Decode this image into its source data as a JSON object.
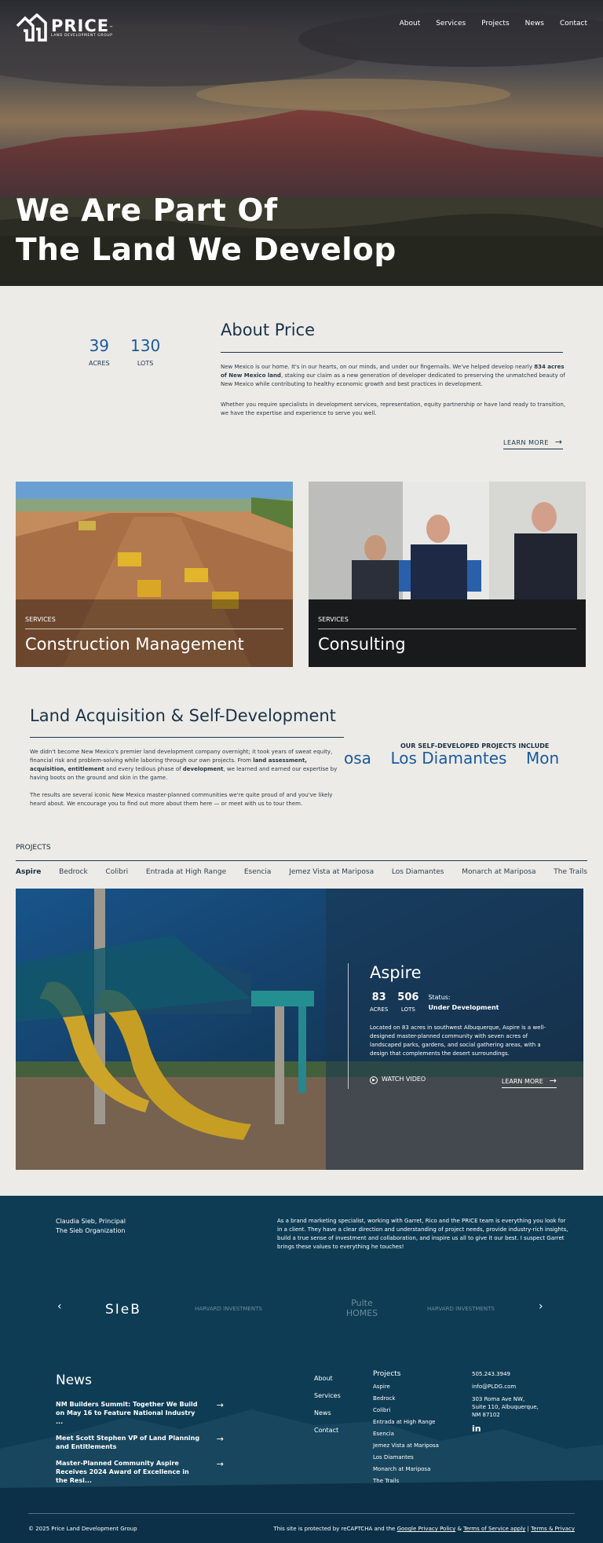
{
  "header": {
    "logo_name": "PRICE",
    "logo_tm": "™",
    "logo_subtitle": "LAND DEVELOPMENT GROUP",
    "nav": [
      "About",
      "Services",
      "Projects",
      "News",
      "Contact"
    ]
  },
  "hero": {
    "title_line1": "We Are Part Of",
    "title_line2": "The Land We Develop"
  },
  "about": {
    "stats": [
      {
        "value": "39",
        "label": "ACRES"
      },
      {
        "value": "130",
        "label": "LOTS"
      }
    ],
    "title": "About Price",
    "p1_a": "New Mexico is our home. It's in our hearts, on our minds, and under our fingernails. We've helped develop nearly ",
    "p1_b": "834 acres of New Mexico land",
    "p1_c": ", staking our claim as a new generation of developer dedicated to preserving the unmatched beauty of New Mexico while contributing to healthy economic growth and best practices in development.",
    "p2": "Whether you require specialists in development services, representation, equity partnership or have land ready to transition, we have the expertise and experience to serve you well.",
    "learn_more": "LEARN MORE"
  },
  "services": [
    {
      "tag": "SERVICES",
      "title": "Construction Management"
    },
    {
      "tag": "SERVICES",
      "title": "Consulting"
    }
  ],
  "acquisition": {
    "title": "Land Acquisition & Self-Development",
    "p1_a": "We didn't become New Mexico's premier land development company overnight; it took years of sweat equity, financial risk and problem-solving while laboring through our own projects. From ",
    "p1_b": "land assessment, acquisition, entitlement",
    "p1_c": " and every tedious phase of ",
    "p1_d": "development",
    "p1_e": ", we learned and earned our expertise by having boots on the ground and skin in the game.",
    "p2": "The results are several iconic New Mexico master-planned communities we're quite proud of and you've likely heard about. We encourage you to find out more about them here — or meet with us to tour them.",
    "marquee_heading": "OUR SELF-DEVELOPED PROJECTS INCLUDE",
    "marquee_items": [
      "osa",
      "Los Diamantes",
      "Mon"
    ]
  },
  "projects": {
    "heading": "PROJECTS",
    "tabs": [
      "Aspire",
      "Bedrock",
      "Colibri",
      "Entrada at High Range",
      "Esencia",
      "Jemez Vista at Mariposa",
      "Los Diamantes",
      "Monarch at Mariposa",
      "The Trails"
    ],
    "active_tab": "Aspire",
    "featured": {
      "name": "Aspire",
      "acres": "83",
      "acres_label": "ACRES",
      "lots": "506",
      "lots_label": "LOTS",
      "status_label": "Status:",
      "status_value": "Under Development",
      "description": "Located on 83 acres in southwest Albuquerque, Aspire is a well-designed master-planned community with seven acres of landscaped parks, gardens, and social gathering areas, with a design that complements the desert surroundings.",
      "watch_video": "WATCH VIDEO",
      "learn_more": "LEARN MORE"
    }
  },
  "testimonial": {
    "name": "Claudia Sieb, Principal",
    "org": "The Sieb Organization",
    "quote": "As a brand marketing specialist, working with Garret, Rico and the PRICE team is everything you look for in a client. They have a clear direction and understanding of project needs, provide industry-rich insights, build a true sense of investment and collaboration, and inspire us all to give it our best. I suspect Garret brings these values to everything he touches!",
    "logos": [
      "SIeB",
      "HARVARD INVESTMENTS",
      "Pulte HOMES",
      "HARVARD INVESTMENTS"
    ]
  },
  "footer": {
    "news_title": "News",
    "news": [
      "NM Builders Summit: Together We Build on May 16 to Feature National Industry ...",
      "Meet Scott Stephen VP of Land Planning and Entitlements",
      "Master-Planned Community Aspire Receives 2024 Award of Excellence in the Resi..."
    ],
    "links": [
      "About",
      "Services",
      "News",
      "Contact"
    ],
    "projects_title": "Projects",
    "projects": [
      "Aspire",
      "Bedrock",
      "Colibri",
      "Entrada at High Range",
      "Esencia",
      "Jemez Vista at Mariposa",
      "Los Diamantes",
      "Monarch at Mariposa",
      "The Trails"
    ],
    "phone": "505.243.3949",
    "email": "info@PLDG.com",
    "addr1": "303 Roma Ave NW,",
    "addr2": "Suite 110, Albuquerque,",
    "addr3": "NM 87102",
    "linkedin": "in",
    "copyright": "© 2025 Price Land Development Group",
    "legal_a": "This site is protected by reCAPTCHA and the ",
    "privacy": "Google Privacy Policy",
    "and": " & ",
    "terms": "Terms of Service apply",
    "sep": " | ",
    "terms_privacy": "Terms & Privacy"
  },
  "colors": {
    "accent_blue": "#1a5a9c",
    "navy": "#0e3c55",
    "bg": "#ecebe8"
  }
}
